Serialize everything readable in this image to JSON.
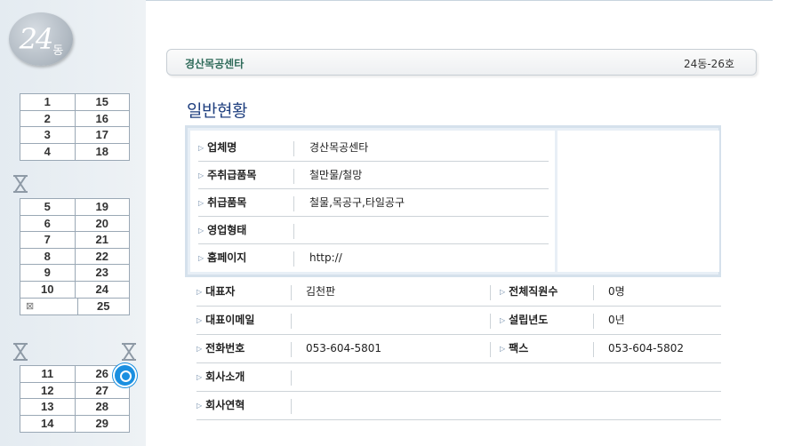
{
  "building": {
    "number": "24",
    "unit": "동"
  },
  "grid_top": [
    [
      "1",
      "15"
    ],
    [
      "2",
      "16"
    ],
    [
      "3",
      "17"
    ],
    [
      "4",
      "18"
    ]
  ],
  "grid_mid": [
    [
      "5",
      "19"
    ],
    [
      "6",
      "20"
    ],
    [
      "7",
      "21"
    ],
    [
      "8",
      "22"
    ],
    [
      "9",
      "23"
    ],
    [
      "10",
      "24"
    ],
    [
      "",
      "25"
    ]
  ],
  "grid_bottom": [
    [
      "11",
      "26"
    ],
    [
      "12",
      "27"
    ],
    [
      "13",
      "28"
    ],
    [
      "14",
      "29"
    ]
  ],
  "header": {
    "company": "경산목공센타",
    "unit": "24동-26호"
  },
  "section_title": "일반현황",
  "info": {
    "company_label": "업체명",
    "company_value": "경산목공센타",
    "main_items_label": "주취급품목",
    "main_items_value": "철만물/철망",
    "items_label": "취급품목",
    "items_value": "철물,목공구,타일공구",
    "business_label": "영업형태",
    "business_value": "",
    "homepage_label": "홈페이지",
    "homepage_value": "http://"
  },
  "details": {
    "ceo_label": "대표자",
    "ceo_value": "김천판",
    "staff_label": "전체직원수",
    "staff_value": "0명",
    "email_label": "대표이메일",
    "email_value": "",
    "founded_label": "설립년도",
    "founded_value": "0년",
    "phone_label": "전화번호",
    "phone_value": "053-604-5801",
    "fax_label": "팩스",
    "fax_value": "053-604-5802",
    "intro_label": "회사소개",
    "intro_value": "",
    "history_label": "회사연혁",
    "history_value": ""
  },
  "colors": {
    "accent": "#1a8fe0",
    "title": "#1f3f7f",
    "company": "#2f6b5a"
  }
}
